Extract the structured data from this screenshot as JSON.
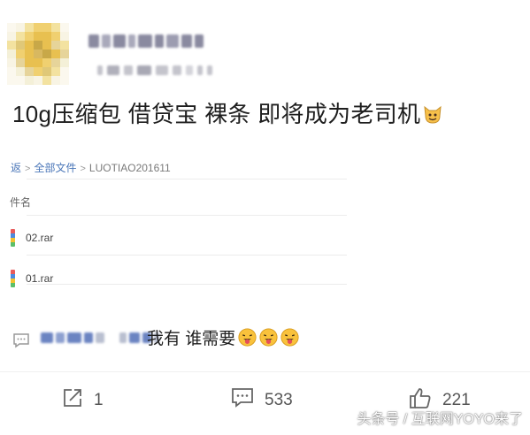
{
  "post": {
    "text": "10g压缩包 借贷宝 裸条 即将成为老司机",
    "emoji": "grinning-cat-emoji"
  },
  "file_browser": {
    "breadcrumb_prefix": "返",
    "breadcrumb_root": "全部文件",
    "breadcrumb_sep": ">",
    "breadcrumb_current": "LUOTIAO201611",
    "column_header": "件名",
    "files": [
      {
        "name": "02.rar",
        "icon": "rar-file-icon"
      },
      {
        "name": "01.rar",
        "icon": "rar-file-icon"
      }
    ]
  },
  "comment": {
    "text": "我有 谁需要",
    "emoji": "tongue-out-emoji"
  },
  "actions": {
    "share_count": "1",
    "comment_count": "533",
    "like_count": "221"
  },
  "watermark": "头条号 / 互联网YOYO来了",
  "colors": {
    "link_blue": "#4a76b8",
    "text": "#1e1e1e",
    "muted": "#555555"
  }
}
